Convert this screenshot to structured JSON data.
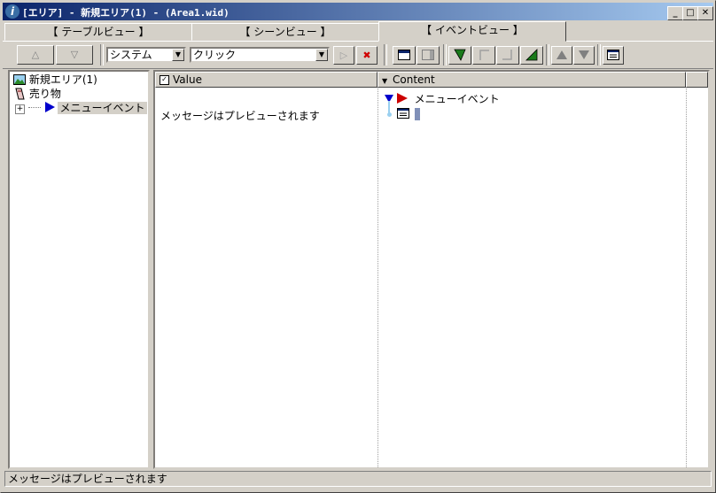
{
  "window": {
    "title": "[エリア] - 新規エリア(1) - (Area1.wid)",
    "app_icon": "i",
    "controls": {
      "minimize": "_",
      "maximize": "□",
      "close": "✕"
    }
  },
  "tabs": [
    {
      "label": "【 テーブルビュー 】",
      "active": false
    },
    {
      "label": "【 シーンビュー 】",
      "active": false
    },
    {
      "label": "【 イベントビュー 】",
      "active": true
    }
  ],
  "toolbar": {
    "up_glyph": "△",
    "down_glyph": "▽",
    "system_select": "システム",
    "click_select": "クリック",
    "play_glyph": "▷",
    "delete_glyph": "✖",
    "select_arrow": "▼"
  },
  "tree": {
    "items": [
      {
        "label": "新規エリア(1)",
        "icon": "landscape-icon"
      },
      {
        "label": "売り物",
        "icon": "item-icon"
      },
      {
        "label": "メニューイベント",
        "icon": "play-arrow-icon",
        "expander": "⊞"
      }
    ]
  },
  "value_column": {
    "header": "Value",
    "header_check": "✓",
    "text": "メッセージはプレビューされます"
  },
  "content_column": {
    "header": "Content",
    "header_arrow": "▼",
    "event_label": "メニューイベント"
  },
  "statusbar": {
    "text": "メッセージはプレビューされます"
  },
  "colors": {
    "title_start": "#0a246a",
    "title_end": "#a6caf0",
    "event_red": "#cc0000",
    "event_blue": "#0000cc"
  }
}
